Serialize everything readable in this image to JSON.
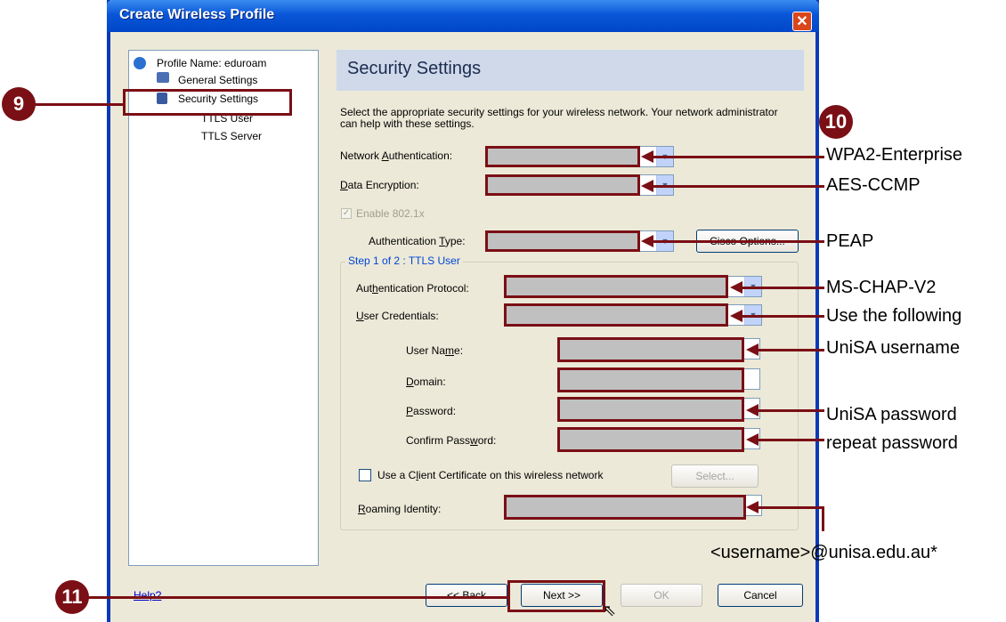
{
  "window": {
    "title": "Create Wireless Profile",
    "close_glyph": "✕"
  },
  "tree": {
    "profile_name": "Profile Name: eduroam",
    "general_settings": "General Settings",
    "security_settings": "Security Settings",
    "ttls_user": "TTLS User",
    "ttls_server": "TTLS Server"
  },
  "header": {
    "title": "Security Settings"
  },
  "intro": "Select the appropriate security settings for your wireless network. Your network administrator can help with these settings.",
  "form": {
    "network_auth_label": "Network Authentication:",
    "data_encryption_label": "Data Encryption:",
    "enable_8021x_label": "Enable 802.1x",
    "auth_type_label": "Authentication Type:",
    "cisco_options": "Cisco Options...",
    "group_title": "Step 1 of 2 : TTLS User",
    "auth_protocol_label": "Authentication Protocol:",
    "user_credentials_label": "User Credentials:",
    "user_name_label": "User Name:",
    "domain_label": "Domain:",
    "password_label": "Password:",
    "confirm_password_label": "Confirm Password:",
    "client_cert_label": "Use a Client Certificate on this wireless network",
    "select_button": "Select...",
    "roaming_identity_label": "Roaming Identity:"
  },
  "footer": {
    "help": "Help?",
    "back": "<< Back",
    "next": "Next >>",
    "ok": "OK",
    "cancel": "Cancel"
  },
  "annotations": {
    "step9": "9",
    "step10": "10",
    "step11": "11",
    "network_auth": "WPA2-Enterprise",
    "data_encryption": "AES-CCMP",
    "auth_type": "PEAP",
    "auth_protocol": "MS-CHAP-V2",
    "user_credentials": "Use the following",
    "user_name": "UniSA username",
    "password": "UniSA password",
    "confirm_password": "repeat password",
    "roaming_identity": "<username>@unisa.edu.au*"
  },
  "colors": {
    "annotation": "#7a0f15",
    "title_bar": "#0a56d8"
  }
}
